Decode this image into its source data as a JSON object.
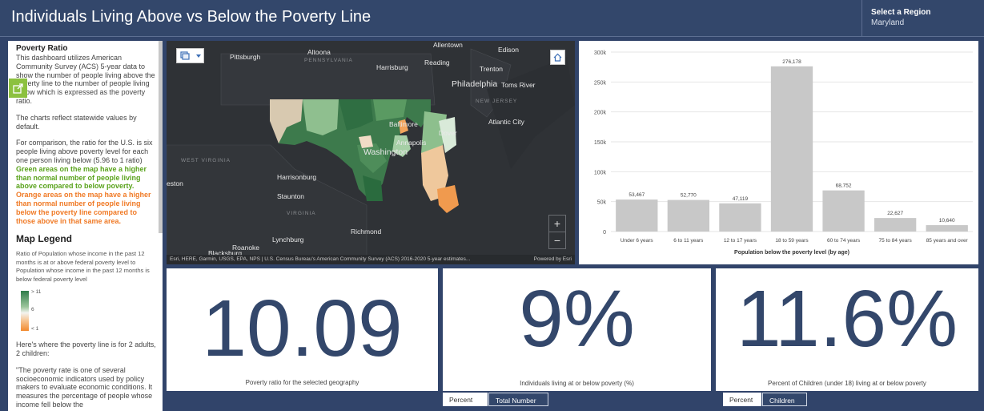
{
  "header": {
    "title": "Individuals Living Above vs Below the Poverty Line",
    "region_label": "Select a Region",
    "region_value": "Maryland"
  },
  "sidebar": {
    "heading": "Poverty Ratio",
    "intro": "This dashboard utilizes American Community Survey (ACS) 5-year data to show the number of people living above the poverty line to the number of people living below which is expressed as the poverty ratio.",
    "statewide": "The charts reflect statewide values by default.",
    "comparison": "For comparison, the ratio for the U.S. is six people living above poverty level for each one person living below (5.96 to 1 ratio)",
    "green_text": "Green areas on the map have a higher than normal number of people living above compared to below poverty.",
    "orange_text": "Orange areas on the map have a higher than normal number of people living below the poverty line compared to those above in that same area.",
    "legend_heading": "Map Legend",
    "legend_desc": "Ratio of Population whose income in the past 12 months is at or above federal poverty level to Population whose income in the past 12 months is below federal poverty level",
    "legend_high": "> 11",
    "legend_mid": "6",
    "legend_low": "< 1",
    "poverty_line_text": "Here's where the poverty line is for 2 adults, 2 children:",
    "quote_text": "\"The poverty rate is one of several socioeconomic indicators used by policy makers to evaluate economic conditions. It measures the percentage of people whose income fell below the"
  },
  "map": {
    "labels": {
      "pittsburgh": "Pittsburgh",
      "altoona": "Altoona",
      "pennsylvania": "PENNSYLVANIA",
      "harrisburg": "Harrisburg",
      "reading": "Reading",
      "allentown": "Allentown",
      "edison": "Edison",
      "trenton": "Trenton",
      "philadelphia": "Philadelphia",
      "toms_river": "Toms River",
      "new_jersey": "NEW JERSEY",
      "baltimore": "Baltimore",
      "dover": "Dover",
      "atlantic_city": "Atlantic City",
      "annapolis": "Annapolis",
      "washington": "Washington",
      "west_virginia": "WEST VIRGINIA",
      "harrisonburg": "Harrisonburg",
      "eston": "eston",
      "staunton": "Staunton",
      "virginia": "VIRGINIA",
      "richmond": "Richmond",
      "lynchburg": "Lynchburg",
      "roanoke": "Roanoke",
      "blacksburg": "Blacksburg"
    },
    "attribution": "Esri, HERE, Garmin, USGS, EPA, NPS | U.S. Census Bureau's American Community Survey (ACS) 2016-2020 5-year estimates...",
    "powered_by": "Powered by Esri",
    "zoom_in": "+",
    "zoom_out": "−"
  },
  "chart_data": {
    "type": "bar",
    "categories": [
      "Under 6 years",
      "6 to 11 years",
      "12 to 17 years",
      "18 to 59 years",
      "60 to 74 years",
      "75 to 84 years",
      "85 years and over"
    ],
    "values": [
      53467,
      52770,
      47119,
      276178,
      68752,
      22627,
      10640
    ],
    "data_labels": [
      "53,467",
      "52,770",
      "47,119",
      "276,178",
      "68,752",
      "22,627",
      "10,640"
    ],
    "xlabel": "Population below the poverty level (by age)",
    "ylabel": "",
    "ylim": [
      0,
      300000
    ],
    "yticks": [
      0,
      50000,
      100000,
      150000,
      200000,
      250000,
      300000
    ],
    "ytick_labels": [
      "0",
      "50k",
      "100k",
      "150k",
      "200k",
      "250k",
      "300k"
    ],
    "bar_color": "#c8c8c8"
  },
  "cards": {
    "ratio": {
      "value": "10.09",
      "caption": "Poverty ratio for the selected geography"
    },
    "individuals": {
      "value": "9%",
      "caption": "Individuals living at or below poverty (%)",
      "tab1": "Percent",
      "tab2": "Total Number"
    },
    "children": {
      "value": "11.6%",
      "caption": "Percent of Children (under 18) living at or below poverty",
      "tab1": "Percent",
      "tab2": "Children"
    }
  }
}
